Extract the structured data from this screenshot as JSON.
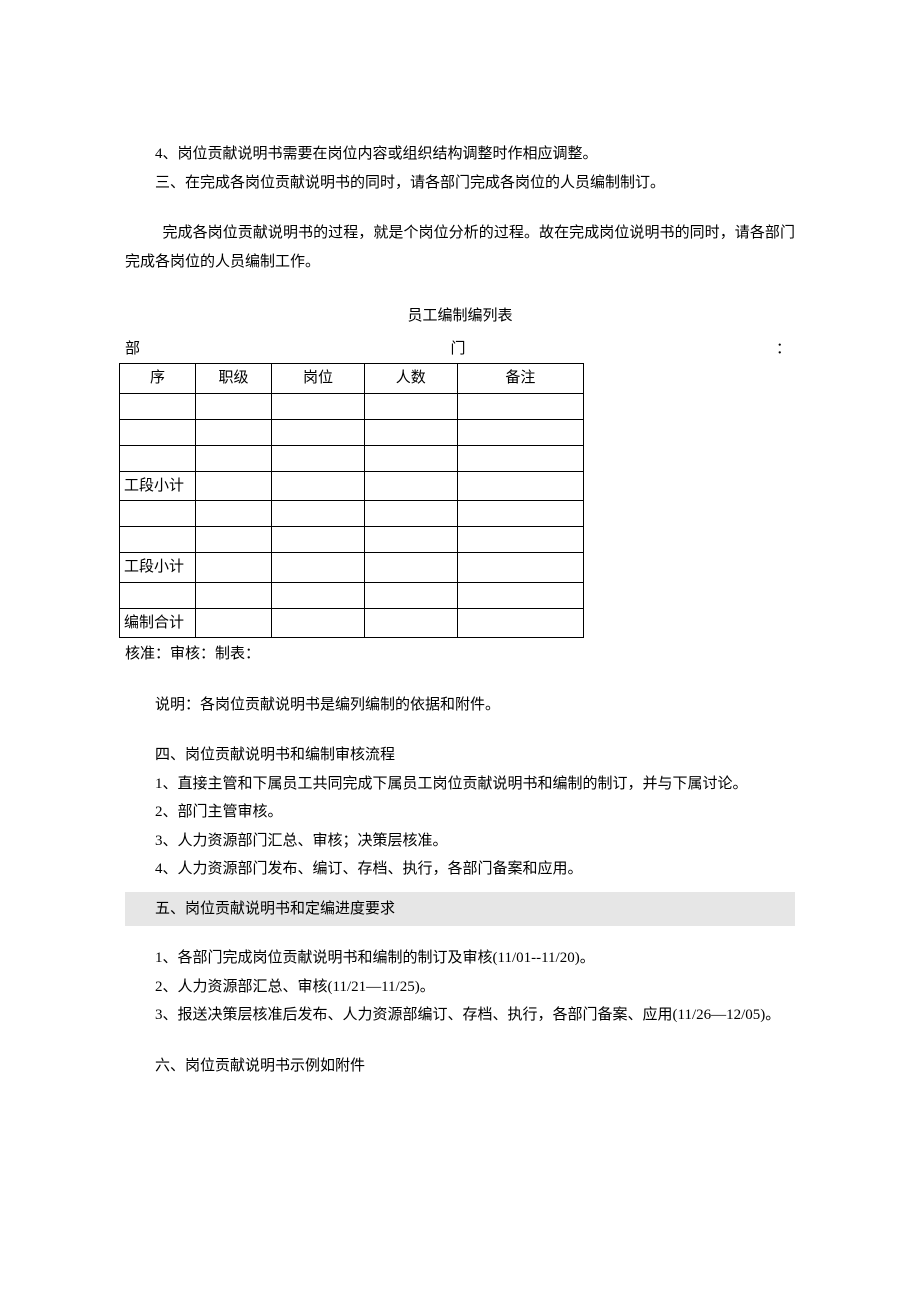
{
  "top": {
    "p1": "4、岗位贡献说明书需要在岗位内容或组织结构调整时作相应调整。",
    "p2": "三、在完成各岗位贡献说明书的同时，请各部门完成各岗位的人员编制制订。",
    "p3": "完成各岗位贡献说明书的过程，就是个岗位分析的过程。故在完成岗位说明书的同时，请各部门完成各岗位的人员编制工作。"
  },
  "table": {
    "title": "员工编制编列表",
    "deptLabelLeft": "部",
    "deptLabelRight": "门",
    "deptColon": "：",
    "headers": {
      "seq": "序",
      "rank": "职级",
      "post": "岗位",
      "count": "人数",
      "note": "备注"
    },
    "subtotal1": "工段小计",
    "subtotal2": "工段小计",
    "total": "编制合计",
    "footer": "核准：审核：制表："
  },
  "middle": {
    "explain": "说明：各岗位贡献说明书是编列编制的依据和附件。",
    "sec4title": "四、岗位贡献说明书和编制审核流程",
    "s4_1": "1、直接主管和下属员工共同完成下属员工岗位贡献说明书和编制的制订，并与下属讨论。",
    "s4_2": "2、部门主管审核。",
    "s4_3": "3、人力资源部门汇总、审核；决策层核准。",
    "s4_4": "4、人力资源部门发布、编订、存档、执行，各部门备案和应用。"
  },
  "section5": {
    "title": "五、岗位贡献说明书和定编进度要求",
    "s5_1": "1、各部门完成岗位贡献说明书和编制的制订及审核(11/01--11/20)。",
    "s5_2": "2、人力资源部汇总、审核(11/21—11/25)。",
    "s5_3": "3、报送决策层核准后发布、人力资源部编订、存档、执行，各部门备案、应用(11/26—12/05)。"
  },
  "section6": {
    "title": "六、岗位贡献说明书示例如附件"
  }
}
